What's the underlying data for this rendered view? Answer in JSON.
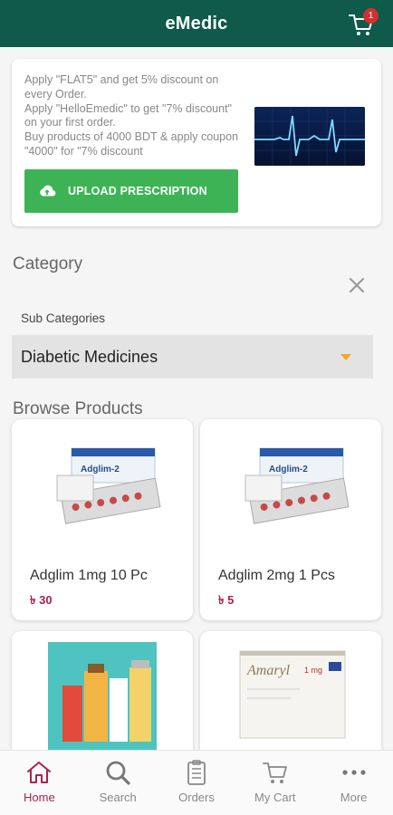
{
  "app": {
    "title": "eMedic",
    "cart_count": "1"
  },
  "promo": {
    "lines": [
      "Apply \"FLAT5\" and get 5% discount on every Order.",
      "Apply \"HelloEmedic\" to get \"7% discount\" on your first order.",
      "Buy products of 4000 BDT & apply coupon \"4000\" for \"7% discount"
    ],
    "upload_label": "UPLOAD PRESCRIPTION",
    "image_icon": "ecg-heartbeat-image"
  },
  "category": {
    "label": "Category",
    "sub_label": "Sub Categories",
    "selected": "Diabetic Medicines"
  },
  "browse": {
    "label": "Browse Products"
  },
  "products": [
    {
      "name": "Adglim 1mg 10 Pc",
      "price": "৳ 30"
    },
    {
      "name": "Adglim 2mg 1 Pcs",
      "price": "৳ 5"
    },
    {
      "name": "",
      "price": ""
    },
    {
      "name": "",
      "price": ""
    }
  ],
  "nav": [
    {
      "label": "Home",
      "icon": "home-icon",
      "active": true
    },
    {
      "label": "Search",
      "icon": "search-icon",
      "active": false
    },
    {
      "label": "Orders",
      "icon": "orders-icon",
      "active": false
    },
    {
      "label": "My Cart",
      "icon": "cart-icon",
      "active": false
    },
    {
      "label": "More",
      "icon": "more-icon",
      "active": false
    }
  ],
  "colors": {
    "appbar": "#0f5a4a",
    "accent_green": "#3eb356",
    "price": "#a8234e",
    "dropdown_arrow": "#f5a623"
  }
}
